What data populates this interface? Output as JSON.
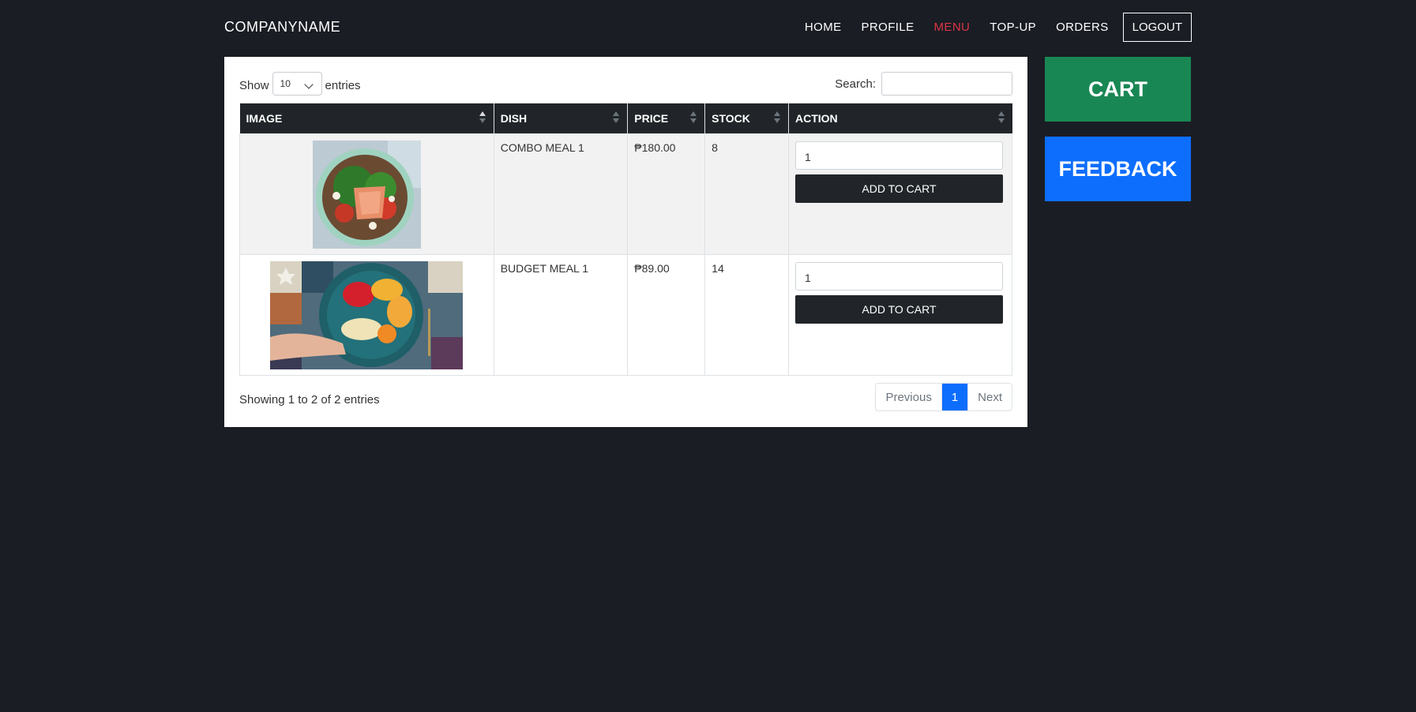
{
  "navbar": {
    "brand": "COMPANYNAME",
    "links": [
      {
        "label": "HOME"
      },
      {
        "label": "PROFILE"
      },
      {
        "label": "MENU",
        "active": true
      },
      {
        "label": "TOP-UP"
      },
      {
        "label": "ORDERS"
      }
    ],
    "logout_label": "LOGOUT",
    "active_color": "#dc3545"
  },
  "table_controls": {
    "show_label": "Show",
    "entries_label": "entries",
    "page_length": "10",
    "search_label": "Search:",
    "search_value": ""
  },
  "table": {
    "columns": [
      "IMAGE",
      "DISH",
      "PRICE",
      "STOCK",
      "ACTION"
    ],
    "rows": [
      {
        "image": "salad-bowl-image",
        "dish": "COMBO MEAL 1",
        "price": "₱180.00",
        "stock": "8",
        "qty": "1",
        "action_label": "ADD TO CART"
      },
      {
        "image": "fruit-bowl-image",
        "dish": "BUDGET MEAL 1",
        "price": "₱89.00",
        "stock": "14",
        "qty": "1",
        "action_label": "ADD TO CART"
      }
    ]
  },
  "footer": {
    "info": "Showing 1 to 2 of 2 entries",
    "prev_label": "Previous",
    "current_page": "1",
    "next_label": "Next"
  },
  "side": {
    "cart_label": "CART",
    "feedback_label": "FEEDBACK",
    "cart_color": "#198754",
    "feedback_color": "#0d6efd"
  }
}
